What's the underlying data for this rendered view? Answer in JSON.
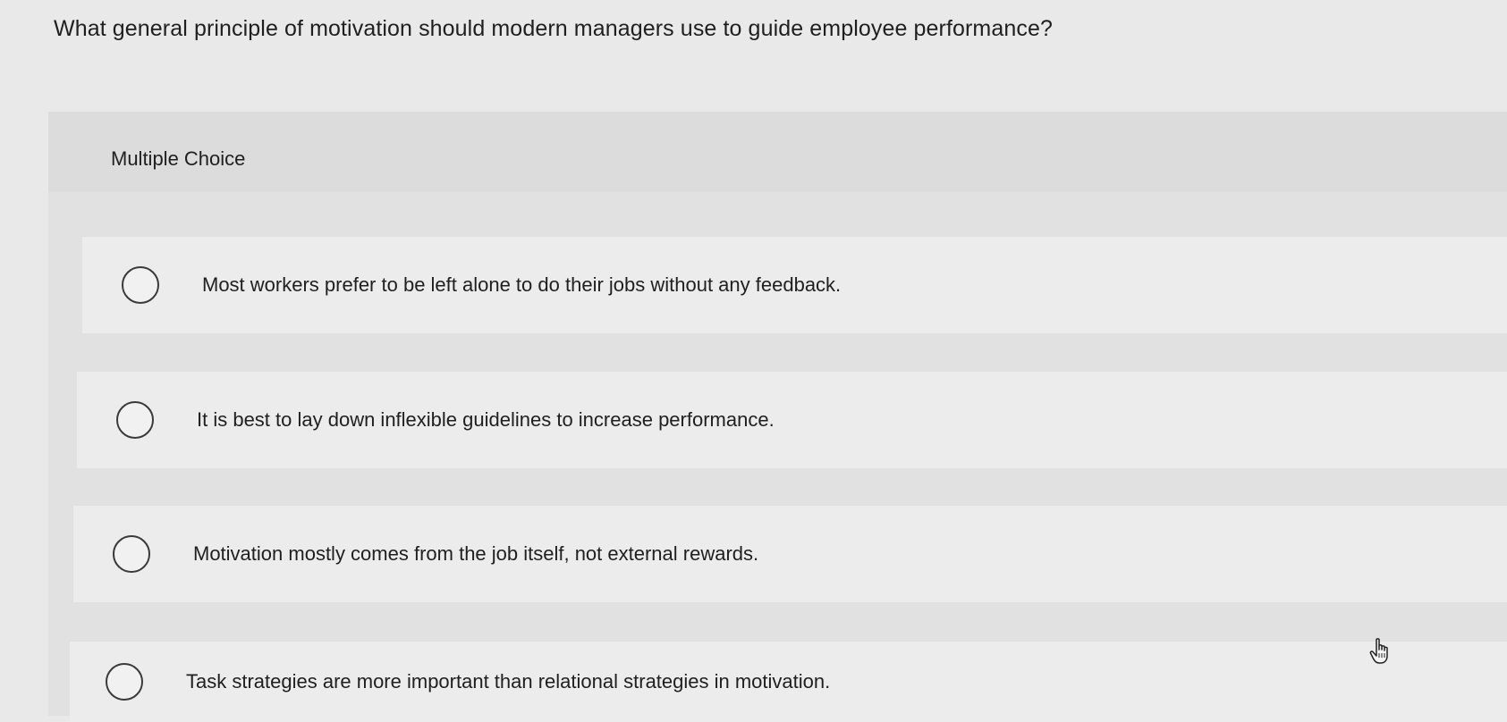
{
  "question": {
    "text": "What general principle of motivation should modern managers use to guide employee performance?"
  },
  "section": {
    "label": "Multiple Choice"
  },
  "options": [
    {
      "text": "Most workers prefer to be left alone to do their jobs without any feedback.",
      "selected": false
    },
    {
      "text": "It is best to lay down inflexible guidelines to increase performance.",
      "selected": false
    },
    {
      "text": "Motivation mostly comes from the job itself, not external rewards.",
      "selected": false
    },
    {
      "text": "Task strategies are more important than relational strategies in motivation.",
      "selected": false
    }
  ],
  "cursor": {
    "icon": "hand-pointer-icon"
  },
  "colors": {
    "background": "#e9e9e9",
    "panel": "#e1e1e1",
    "option_row": "#ececec",
    "text": "#1f1f1f"
  }
}
